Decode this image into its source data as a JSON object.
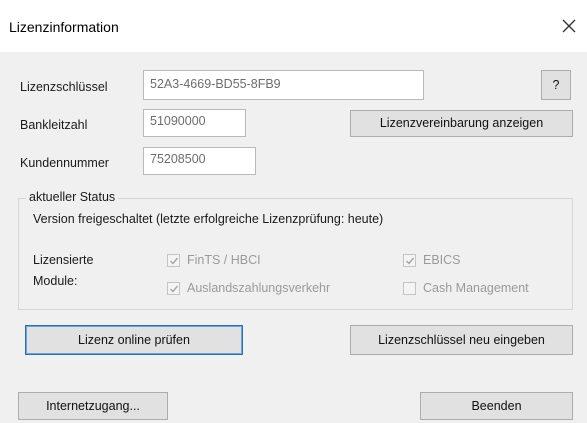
{
  "window": {
    "title": "Lizenzinformation"
  },
  "license": {
    "key_label": "Lizenzschlüssel",
    "key_value": "52A3-4669-BD55-8FB9",
    "help_label": "?",
    "blz_label": "Bankleitzahl",
    "blz_value": "51090000",
    "agreement_button": "Lizenzvereinbarung anzeigen",
    "customer_label": "Kundennummer",
    "customer_value": "75208500"
  },
  "status": {
    "group_title": "aktueller Status",
    "text": "Version freigeschaltet (letzte erfolgreiche Lizenzprüfung: heute)",
    "modules_label_line1": "Lizensierte",
    "modules_label_line2": "Module:",
    "modules": [
      {
        "label": "FinTS / HBCI",
        "checked": true
      },
      {
        "label": "EBICS",
        "checked": true
      },
      {
        "label": "Auslandszahlungsverkehr",
        "checked": true
      },
      {
        "label": "Cash Management",
        "checked": false
      }
    ]
  },
  "actions": {
    "check_online": "Lizenz online prüfen",
    "reenter_key": "Lizenzschlüssel neu eingeben",
    "internet_access": "Internetzugang...",
    "quit": "Beenden"
  },
  "colors": {
    "accent": "#2f6fb4",
    "disabled_text": "#9a9a9a"
  },
  "icons": {
    "close": "close-icon",
    "check": "checkmark-icon"
  }
}
